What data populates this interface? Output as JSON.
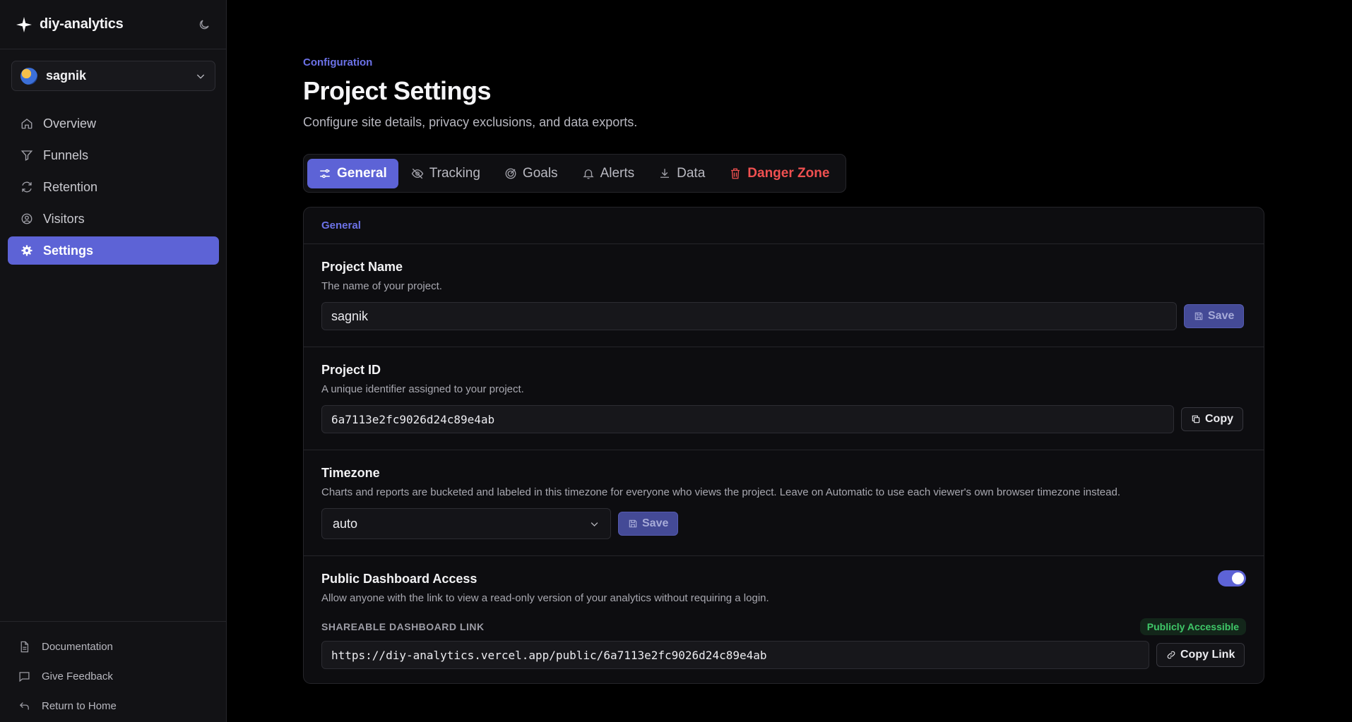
{
  "brand": {
    "name": "diy-analytics"
  },
  "project_selector": {
    "name": "sagnik"
  },
  "nav": {
    "items": [
      {
        "label": "Overview",
        "icon": "home-icon"
      },
      {
        "label": "Funnels",
        "icon": "filter-icon"
      },
      {
        "label": "Retention",
        "icon": "refresh-icon"
      },
      {
        "label": "Visitors",
        "icon": "user-circle-icon"
      },
      {
        "label": "Settings",
        "icon": "gear-icon",
        "active": true
      }
    ]
  },
  "footer": {
    "documentation": "Documentation",
    "feedback": "Give Feedback",
    "home": "Return to Home"
  },
  "header": {
    "eyebrow": "Configuration",
    "title": "Project Settings",
    "subtitle": "Configure site details, privacy exclusions, and data exports."
  },
  "tabs": [
    {
      "label": "General",
      "active": true
    },
    {
      "label": "Tracking"
    },
    {
      "label": "Goals"
    },
    {
      "label": "Alerts"
    },
    {
      "label": "Data"
    },
    {
      "label": "Danger Zone",
      "danger": true
    }
  ],
  "panel": {
    "heading": "General",
    "project_name": {
      "title": "Project Name",
      "desc": "The name of your project.",
      "value": "sagnik",
      "button": "Save"
    },
    "project_id": {
      "title": "Project ID",
      "desc": "A unique identifier assigned to your project.",
      "value": "6a7113e2fc9026d24c89e4ab",
      "button": "Copy"
    },
    "timezone": {
      "title": "Timezone",
      "desc": "Charts and reports are bucketed and labeled in this timezone for everyone who views the project. Leave on Automatic to use each viewer's own browser timezone instead.",
      "value": "auto",
      "button": "Save"
    },
    "public_access": {
      "title": "Public Dashboard Access",
      "desc": "Allow anyone with the link to view a read-only version of your analytics without requiring a login.",
      "enabled": true,
      "link_label": "SHAREABLE DASHBOARD LINK",
      "status": "Publicly Accessible",
      "link": "https://diy-analytics.vercel.app/public/6a7113e2fc9026d24c89e4ab",
      "button": "Copy Link"
    }
  },
  "colors": {
    "accent": "#5d63d6",
    "danger": "#ef5050",
    "success": "#3fc768"
  }
}
